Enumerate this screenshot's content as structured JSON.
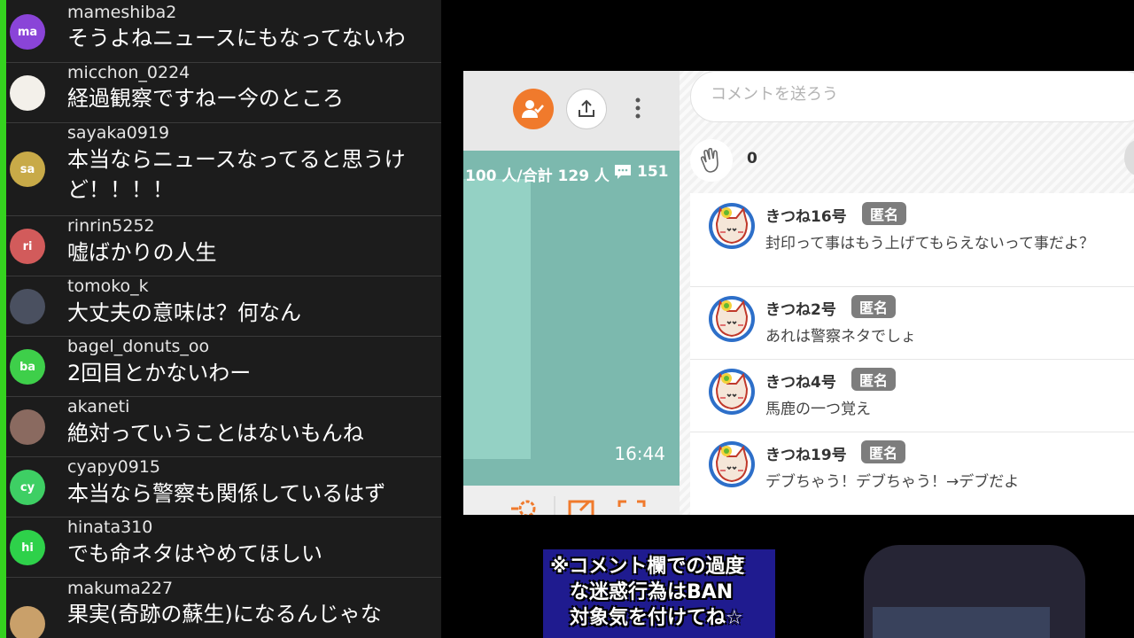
{
  "chat": {
    "messages": [
      {
        "user": "mameshiba2",
        "text": "そうよねニュースにもなってないわ",
        "avatar": "ma",
        "color": "#8a44d8"
      },
      {
        "user": "micchon_0224",
        "text": "経過観察ですねー今のところ",
        "avatar": "",
        "color": "#f3f0ea"
      },
      {
        "user": "sayaka0919",
        "text": "本当ならニュースなってると思うけど！！！！",
        "avatar": "sa",
        "color": "#c8aa48"
      },
      {
        "user": "rinrin5252",
        "text": "嘘ばかりの人生",
        "avatar": "ri",
        "color": "#d25b5b"
      },
      {
        "user": "tomoko_k",
        "text": "大丈夫の意味は？何なん",
        "avatar": "",
        "color": "#4a5060"
      },
      {
        "user": "bagel_donuts_oo",
        "text": "2回目とかないわー",
        "avatar": "ba",
        "color": "#3ecf4a"
      },
      {
        "user": "akaneti",
        "text": "絶対っていうことはないもんね",
        "avatar": "",
        "color": "#8a6a60"
      },
      {
        "user": "cyapy0915",
        "text": "本当なら警察も関係しているはず",
        "avatar": "cy",
        "color": "#3ecf64"
      },
      {
        "user": "hinata310",
        "text": "でも命ネタはやめてほしい",
        "avatar": "hi",
        "color": "#2ed14a"
      },
      {
        "user": "makuma227",
        "text": "果実(奇跡の蘇生)になるんじゃな",
        "avatar": "",
        "color": "#c9a06a"
      }
    ]
  },
  "stream": {
    "viewers": "100 人/合計 129 人",
    "comment_count": "151",
    "time": "16:44"
  },
  "comments_panel": {
    "placeholder": "コメントを送ろう",
    "clap_count": "0",
    "items": [
      {
        "name": "きつね16号",
        "badge": "匿名",
        "body": "封印って事はもう上げてもらえないって事だよ？"
      },
      {
        "name": "きつね2号",
        "badge": "匿名",
        "body": "あれは警察ネタでしょ"
      },
      {
        "name": "きつね4号",
        "badge": "匿名",
        "body": "馬鹿の一つ覚え"
      },
      {
        "name": "きつね19号",
        "badge": "匿名",
        "body": "デブちゃう！デブちゃう！→デブだよ"
      }
    ]
  },
  "notice": {
    "line1": "※コメント欄での過度",
    "line2": "な迷惑行為はBAN",
    "line3": "対象気を付けてね☆"
  },
  "colors": {
    "accent": "#f07a2c",
    "chat_stripe": "#35d21f",
    "video": "#7cb9ae",
    "badge": "#7d7d7d"
  }
}
